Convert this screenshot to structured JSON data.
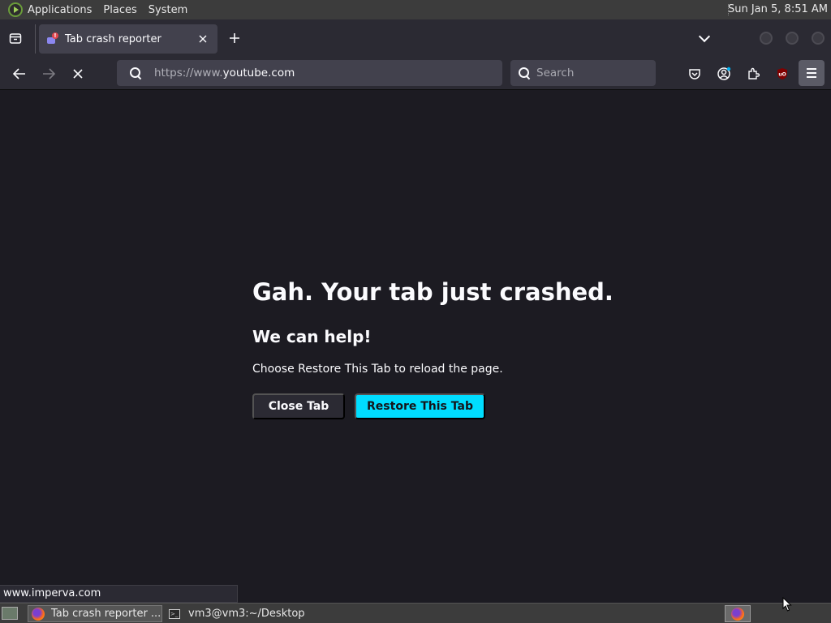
{
  "system_bar": {
    "menus": [
      "Applications",
      "Places",
      "System"
    ],
    "clock": "Sun Jan  5,  8:51 AM"
  },
  "browser": {
    "tab": {
      "title": "Tab crash reporter"
    },
    "url": {
      "prefix": "https://www.",
      "domain": "youtube.com"
    },
    "search_placeholder": "Search"
  },
  "crash_page": {
    "title": "Gah. Your tab just crashed.",
    "subtitle": "We can help!",
    "message": "Choose Restore This Tab to reload the page.",
    "close_label": "Close Tab",
    "restore_label": "Restore This Tab"
  },
  "status_link": "www.imperva.com",
  "taskbar": {
    "items": [
      {
        "label": "Tab crash reporter ..."
      },
      {
        "label": "vm3@vm3:~/Desktop"
      }
    ]
  },
  "colors": {
    "accent": "#00ddff",
    "page_bg": "#1c1b22",
    "toolbar_bg": "#2b2a33"
  }
}
